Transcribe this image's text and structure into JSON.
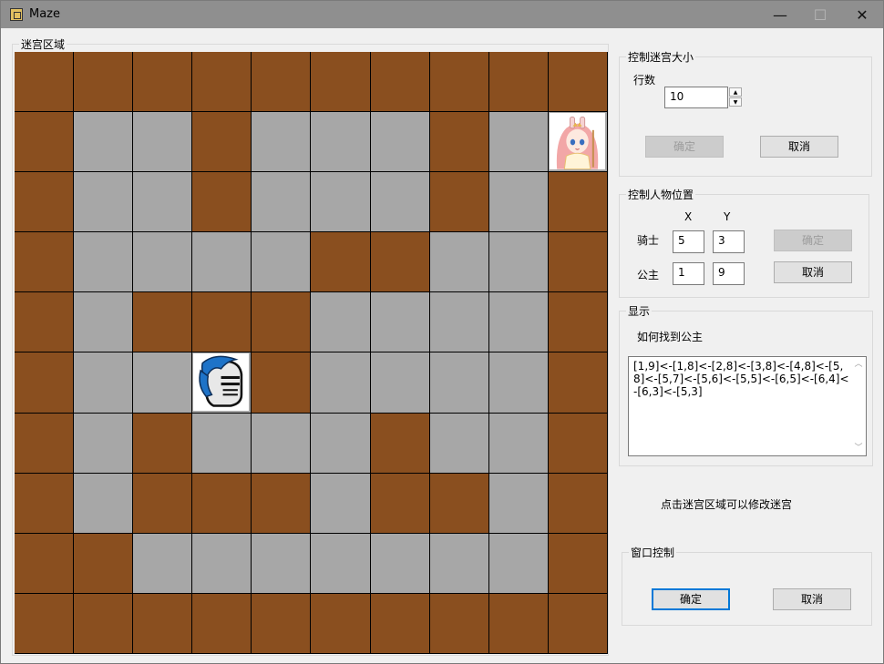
{
  "window": {
    "title": "Maze",
    "minimize": "—",
    "maximize": "☐",
    "close": "✕"
  },
  "maze": {
    "group_title": "迷宫区域",
    "rows": 10,
    "grid": [
      [
        1,
        1,
        1,
        1,
        1,
        1,
        1,
        1,
        1,
        1
      ],
      [
        1,
        0,
        0,
        1,
        0,
        0,
        0,
        1,
        0,
        0
      ],
      [
        1,
        0,
        0,
        1,
        0,
        0,
        0,
        1,
        0,
        1
      ],
      [
        1,
        0,
        0,
        0,
        0,
        1,
        1,
        0,
        0,
        1
      ],
      [
        1,
        0,
        1,
        1,
        1,
        0,
        0,
        0,
        0,
        1
      ],
      [
        1,
        0,
        0,
        0,
        1,
        0,
        0,
        0,
        0,
        1
      ],
      [
        1,
        0,
        1,
        0,
        0,
        0,
        1,
        0,
        0,
        1
      ],
      [
        1,
        0,
        1,
        1,
        1,
        0,
        1,
        1,
        0,
        1
      ],
      [
        1,
        1,
        0,
        0,
        0,
        0,
        0,
        0,
        0,
        1
      ],
      [
        1,
        1,
        1,
        1,
        1,
        1,
        1,
        1,
        1,
        1
      ]
    ],
    "knight_cell": {
      "row": 5,
      "col": 3
    },
    "princess_cell": {
      "row": 1,
      "col": 9
    },
    "colors": {
      "wall": "#8a4f1f",
      "path": "#a7a7a7"
    }
  },
  "size_control": {
    "group_title": "控制迷宫大小",
    "rows_label": "行数",
    "rows_value": "10",
    "confirm_label": "确定",
    "cancel_label": "取消"
  },
  "position_control": {
    "group_title": "控制人物位置",
    "x_header": "X",
    "y_header": "Y",
    "knight_label": "骑士",
    "knight_x": "5",
    "knight_y": "3",
    "princess_label": "公主",
    "princess_x": "1",
    "princess_y": "9",
    "confirm_label": "确定",
    "cancel_label": "取消"
  },
  "display": {
    "group_title": "显示",
    "how_label": "如何找到公主",
    "path_text": "[1,9]<-[1,8]<-[2,8]<-[3,8]<-[4,8]<-[5,8]<-[5,7]<-[5,6]<-[5,5]<-[6,5]<-[6,4]<-[6,3]<-[5,3]"
  },
  "hint": "点击迷宫区域可以修改迷宫",
  "window_control": {
    "group_title": "窗口控制",
    "confirm_label": "确定",
    "cancel_label": "取消"
  }
}
